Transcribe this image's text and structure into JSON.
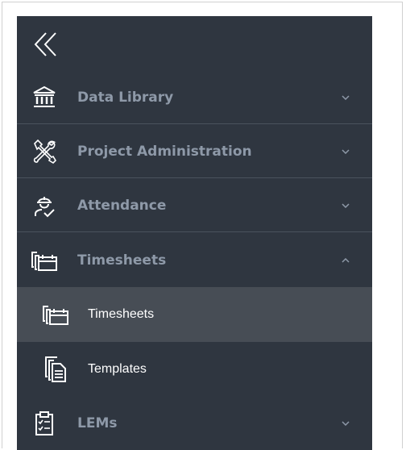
{
  "sidebar": {
    "collapse_icon": "double-chevron-left-icon",
    "sections": [
      {
        "label": "Data Library",
        "icon": "bank-icon",
        "state": "collapsed"
      },
      {
        "label": "Project Administration",
        "icon": "tools-icon",
        "state": "collapsed"
      },
      {
        "label": "Attendance",
        "icon": "worker-check-icon",
        "state": "collapsed"
      },
      {
        "label": "Timesheets",
        "icon": "timesheets-icon",
        "state": "expanded"
      },
      {
        "label": "LEMs",
        "icon": "clipboard-list-icon",
        "state": "collapsed"
      }
    ],
    "timesheets_children": [
      {
        "label": "Timesheets",
        "icon": "timesheets-icon",
        "active": true
      },
      {
        "label": "Templates",
        "icon": "templates-icon",
        "active": false
      }
    ]
  },
  "colors": {
    "sidebar_bg": "#2f3640",
    "active_bg": "#474d55",
    "section_label": "#8e99a8",
    "sub_label": "#ffffff",
    "icon": "#ffffff",
    "divider": "#4a525d"
  }
}
